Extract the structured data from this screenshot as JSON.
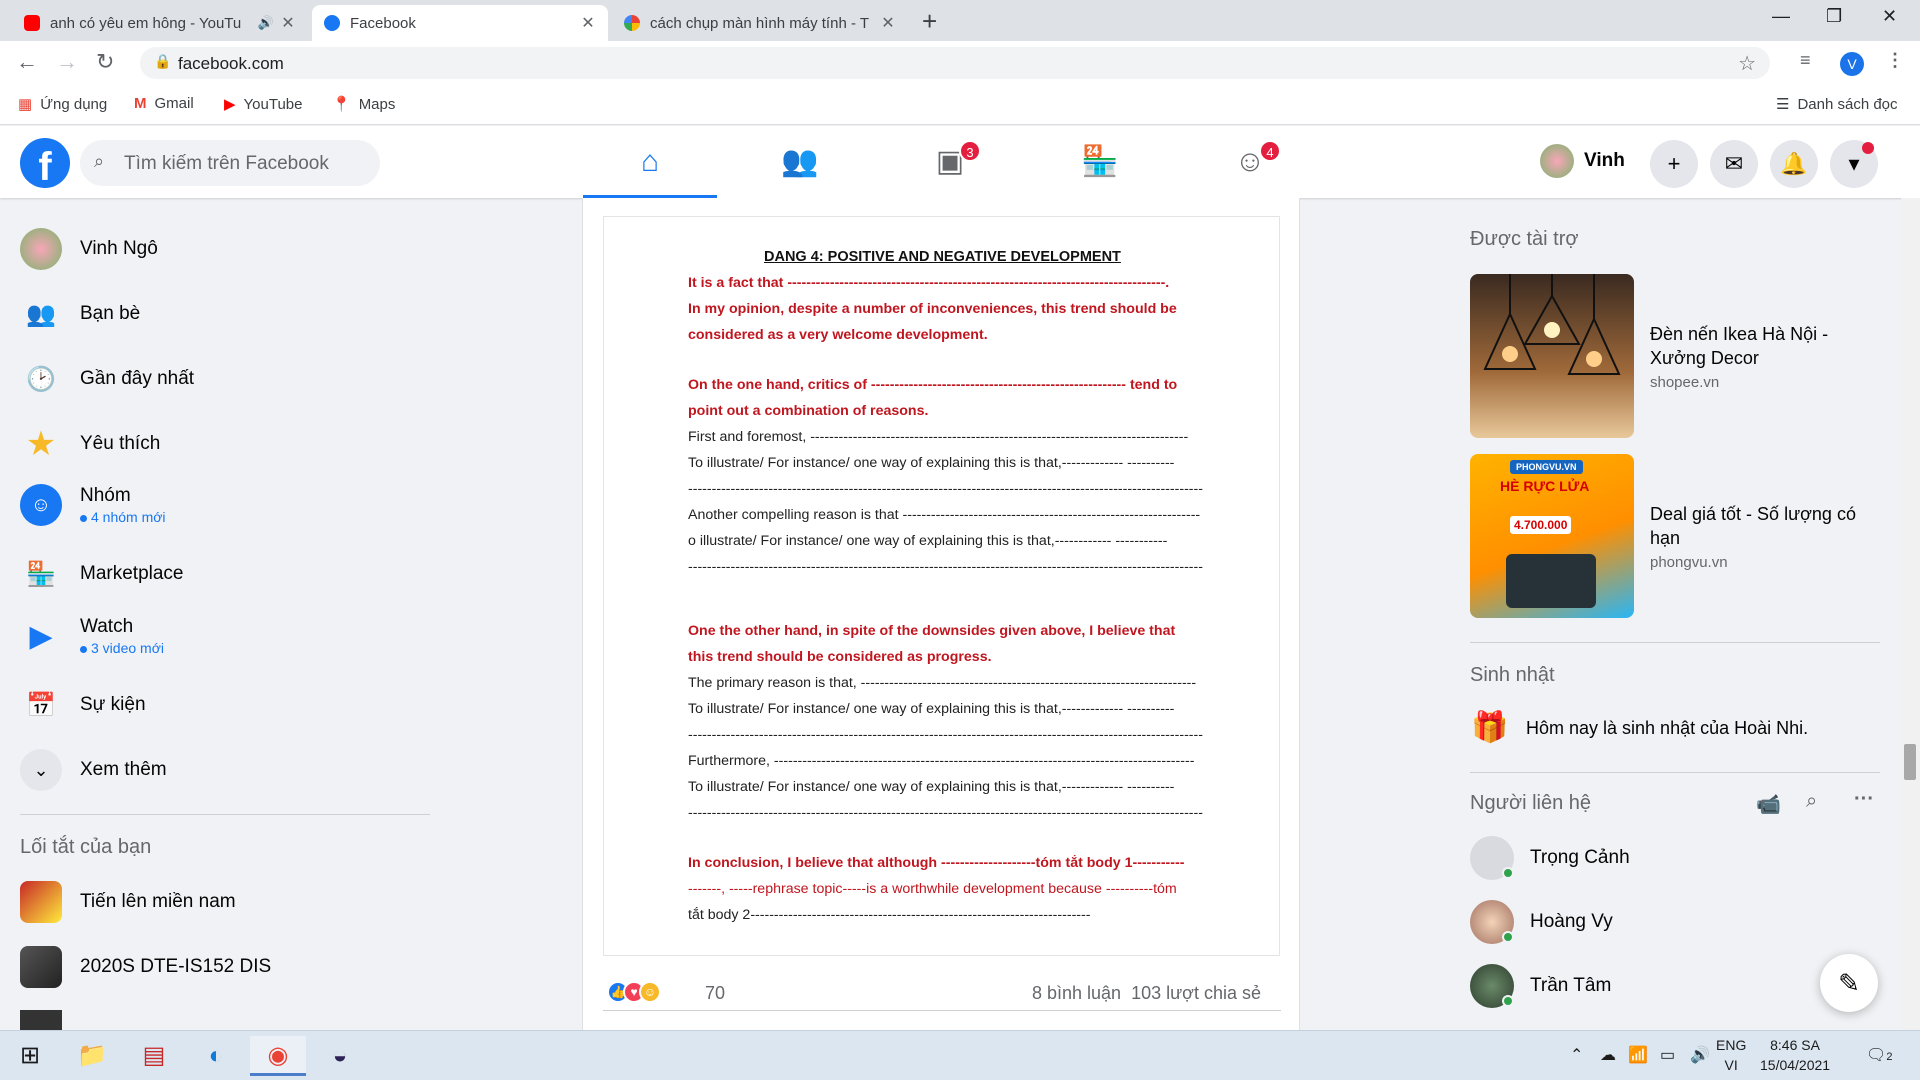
{
  "browser": {
    "tabs": [
      {
        "title": "anh có yêu em hông - YouTu",
        "icon": "youtube-favicon",
        "color": "#ff0000"
      },
      {
        "title": "Facebook",
        "icon": "facebook-favicon",
        "color": "#1877f2"
      },
      {
        "title": "cách chụp màn hình máy tính - T",
        "icon": "google-favicon",
        "color": "#4285f4"
      }
    ],
    "url": "facebook.com",
    "profile_initial": "V",
    "bookmarks": [
      "Ứng dụng",
      "Gmail",
      "YouTube",
      "Maps"
    ],
    "reading_list": "Danh sách đọc"
  },
  "fb": {
    "search_placeholder": "Tìm kiếm trên Facebook",
    "watch_badge": "3",
    "groups_badge": "4",
    "profile_name": "Vinh"
  },
  "left": {
    "items": [
      {
        "label": "Vinh Ngô"
      },
      {
        "label": "Bạn bè"
      },
      {
        "label": "Gần đây nhất"
      },
      {
        "label": "Yêu thích"
      },
      {
        "label": "Nhóm",
        "sub": "4 nhóm mới"
      },
      {
        "label": "Marketplace"
      },
      {
        "label": "Watch",
        "sub": "3 video mới"
      },
      {
        "label": "Sự kiện"
      },
      {
        "label": "Xem thêm"
      }
    ],
    "shortcuts_title": "Lối tắt của bạn",
    "shortcuts": [
      "Tiến lên miền nam",
      "2020S DTE-IS152 DIS"
    ]
  },
  "post": {
    "doc": {
      "heading": "DANG 4: POSITIVE AND NEGATIVE DEVELOPMENT",
      "lines": [
        "It is a fact that --------------------------------------------------------------------------------.",
        "In my opinion, despite a number of inconveniences, this trend should be",
        "considered as a very welcome development.",
        "On the one hand, critics of ------------------------------------------------------ tend to",
        "point out a combination of reasons.",
        "First and foremost, --------------------------------------------------------------------------------",
        "To illustrate/ For instance/ one way of explaining this is that,------------- ----------",
        "-------------------------------------------------------------------------------------------------------------",
        "Another compelling reason is that ---------------------------------------------------------------",
        "o illustrate/ For instance/ one way of explaining this is that,------------ -----------",
        "-------------------------------------------------------------------------------------------------------------",
        "One the other hand, in spite of the downsides given above, I believe that",
        "this trend should be considered as progress.",
        "The primary reason is that, -----------------------------------------------------------------------",
        "To illustrate/ For instance/ one way of explaining this is that,------------- ----------",
        "-------------------------------------------------------------------------------------------------------------",
        "Furthermore, -----------------------------------------------------------------------------------------",
        "To illustrate/ For instance/ one way of explaining this is that,------------- ----------",
        "-------------------------------------------------------------------------------------------------------------",
        "In conclusion, I believe that although --------------------tóm tắt body 1-----------",
        "-------, -----rephrase topic-----is a worthwhile development because ----------tóm",
        "tắt body 2------------------------------------------------------------------------"
      ]
    },
    "reactions_count": "70",
    "comments": "8 bình luận",
    "shares": "103 lượt chia sẻ"
  },
  "right": {
    "sponsored_title": "Được tài trợ",
    "ads": [
      {
        "title": "Đèn nến Ikea Hà Nội - Xưởng Decor",
        "site": "shopee.vn"
      },
      {
        "title": "Deal giá tốt - Số lượng có hạn",
        "site": "phongvu.vn"
      }
    ],
    "ad2_banner": "PHONGVU.VN",
    "ad2_headline": "HÈ RỰC LỬA",
    "ad2_price": "4.700.000",
    "birthday_title": "Sinh nhật",
    "birthday_text": "Hôm nay là sinh nhật của ",
    "birthday_name": "Hoài Nhi",
    "contacts_title": "Người liên hệ",
    "contacts": [
      "Trọng Cảnh",
      "Hoàng Vy",
      "Trần Tâm"
    ]
  },
  "taskbar": {
    "lang_top": "ENG",
    "lang_bottom": "VI",
    "time": "8:46 SA",
    "date": "15/04/2021",
    "notif_count": "2"
  }
}
